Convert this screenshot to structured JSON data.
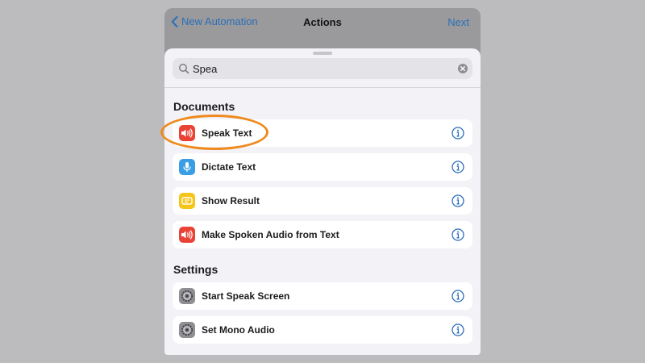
{
  "nav": {
    "back_label": "New Automation",
    "title": "Actions",
    "next_label": "Next"
  },
  "search": {
    "value": "Spea",
    "placeholder": "Search"
  },
  "sections": [
    {
      "title": "Documents",
      "rows": [
        {
          "label": "Speak Text",
          "icon": "speaker-icon"
        },
        {
          "label": "Dictate Text",
          "icon": "microphone-icon"
        },
        {
          "label": "Show Result",
          "icon": "result-icon"
        },
        {
          "label": "Make Spoken Audio from Text",
          "icon": "speaker-icon"
        }
      ]
    },
    {
      "title": "Settings",
      "rows": [
        {
          "label": "Start Speak Screen",
          "icon": "settings-gear-icon"
        },
        {
          "label": "Set Mono Audio",
          "icon": "settings-gear-icon"
        }
      ]
    }
  ],
  "colors": {
    "accent": "#2a6fb8",
    "highlight_ring": "#ee8a1e",
    "speaker_icon_bg": "#ea4336",
    "dictate_icon_bg": "#3a9ee4",
    "result_icon_bg": "#f5c518",
    "settings_icon_bg": "#8e8e93"
  }
}
